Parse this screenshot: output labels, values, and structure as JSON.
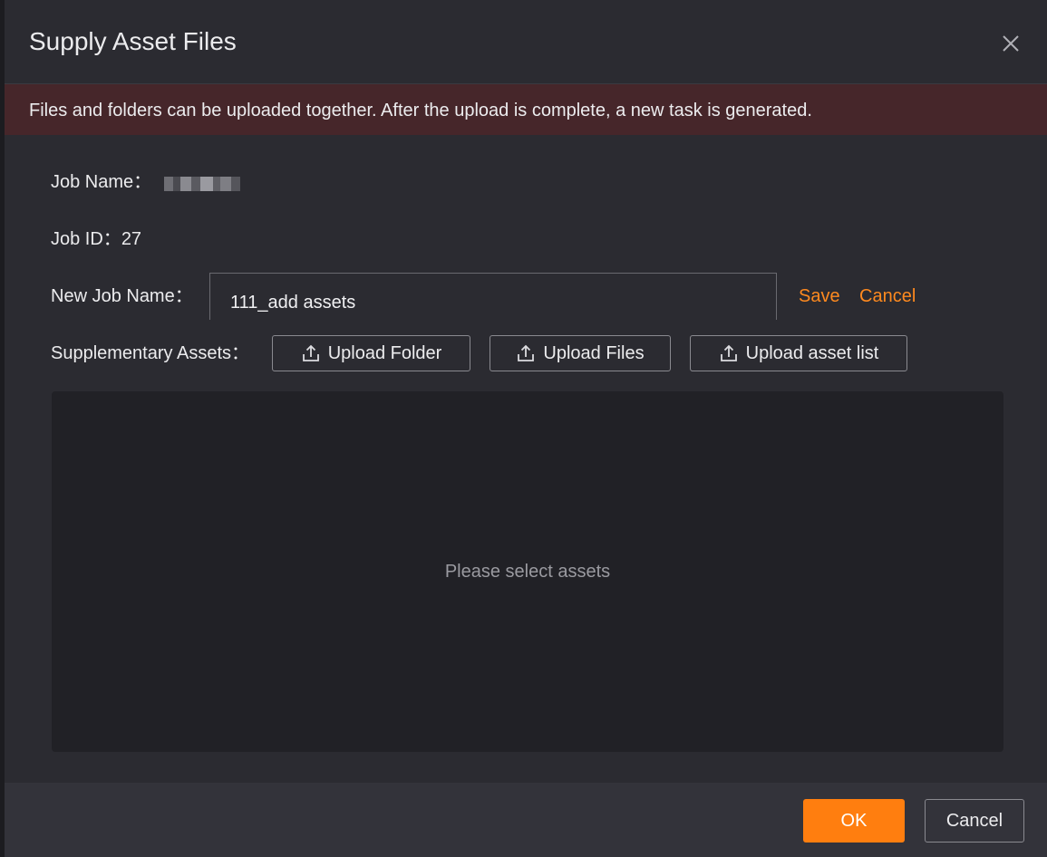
{
  "dialog": {
    "title": "Supply Asset Files",
    "close_icon": "close-icon"
  },
  "alert": {
    "text": "Files and folders can be uploaded together. After the upload is complete, a new task is generated."
  },
  "form": {
    "job_name_label": "Job Name：",
    "job_id_label": "Job ID：",
    "job_id_value": "27",
    "new_job_name_label": "New Job Name：",
    "new_job_name_value": "111_add assets",
    "save_label": "Save",
    "cancel_label": "Cancel",
    "supplementary_label": "Supplementary Assets：",
    "upload_folder_label": "Upload Folder",
    "upload_files_label": "Upload Files",
    "upload_asset_list_label": "Upload asset list",
    "upload_icon": "upload-icon"
  },
  "assets": {
    "empty_text": "Please select assets"
  },
  "footer": {
    "ok_label": "OK",
    "cancel_label": "Cancel"
  },
  "colors": {
    "accent": "#ff7e0f",
    "alert_bg": "#46262a",
    "dialog_bg": "#2b2b31"
  }
}
